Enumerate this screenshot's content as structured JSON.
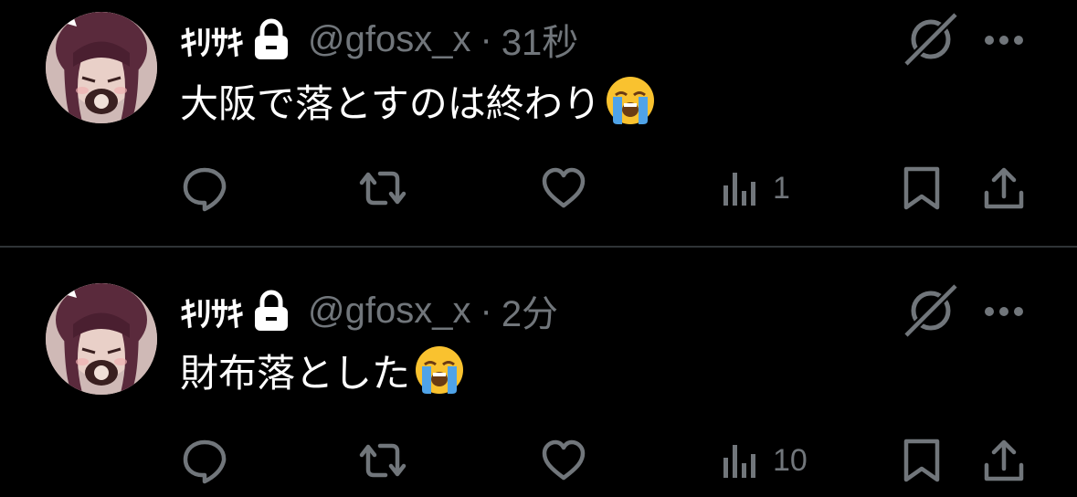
{
  "tweets": [
    {
      "name": "ｷﾘｻｷ",
      "handle": "@gfosx_x",
      "separator": "·",
      "time": "31秒",
      "text": "大阪で落とすのは終わり",
      "emoji": "loudly-crying-face",
      "views": "1"
    },
    {
      "name": "ｷﾘｻｷ",
      "handle": "@gfosx_x",
      "separator": "·",
      "time": "2分",
      "text": "財布落とした",
      "emoji": "loudly-crying-face",
      "views": "10"
    }
  ],
  "icons": {
    "lock": "lock-icon",
    "grok": "grok-icon",
    "more": "more-icon",
    "reply": "reply-icon",
    "retweet": "retweet-icon",
    "like": "heart-icon",
    "views": "analytics-icon",
    "bookmark": "bookmark-icon",
    "share": "share-icon"
  },
  "colors": {
    "background": "#000000",
    "primary_text": "#ffffff",
    "secondary_text": "#71767b",
    "divider": "#2f3336"
  }
}
